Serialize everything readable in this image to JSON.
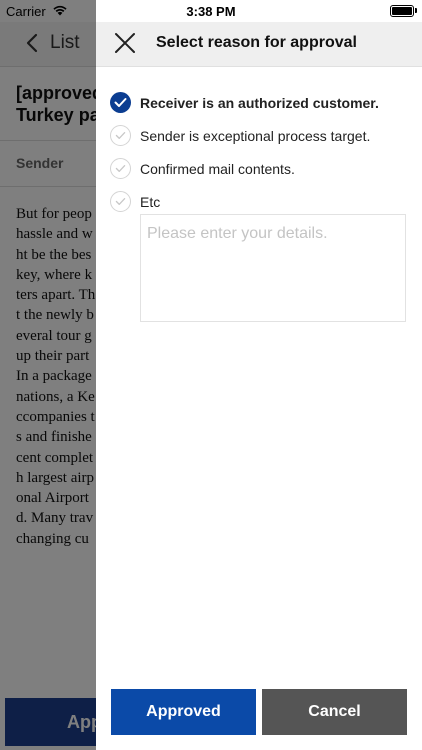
{
  "status_bar": {
    "carrier": "Carrier",
    "time": "3:38 PM"
  },
  "background": {
    "back_label": "List",
    "title": "[approved\nTurkey pa",
    "sender_label": "Sender",
    "body_lines": [
      "But for peop",
      "hassle and w",
      "ht be the bes",
      "key, where k",
      "ters apart. Th",
      "t the newly b",
      "everal tour g",
      "up their part",
      "In a package",
      "nations, a Ke",
      "ccompanies t",
      "s and finishe",
      "cent complet",
      "h largest airp",
      "onal Airport",
      "d. Many trav",
      "changing cu"
    ],
    "bottom_button_label": "App"
  },
  "drawer": {
    "title": "Select reason for approval",
    "reasons": [
      {
        "label": "Receiver is an authorized customer.",
        "checked": true
      },
      {
        "label": "Sender is exceptional process target.",
        "checked": false
      },
      {
        "label": "Confirmed mail contents.",
        "checked": false
      },
      {
        "label": "Etc",
        "checked": false
      }
    ],
    "details": {
      "placeholder": "Please enter your details.",
      "value": ""
    },
    "approve_label": "Approved",
    "cancel_label": "Cancel"
  },
  "colors": {
    "primary": "#0b4aa8",
    "checked": "#0b3d91",
    "cancel": "#555555",
    "header_bg": "#efefef"
  }
}
